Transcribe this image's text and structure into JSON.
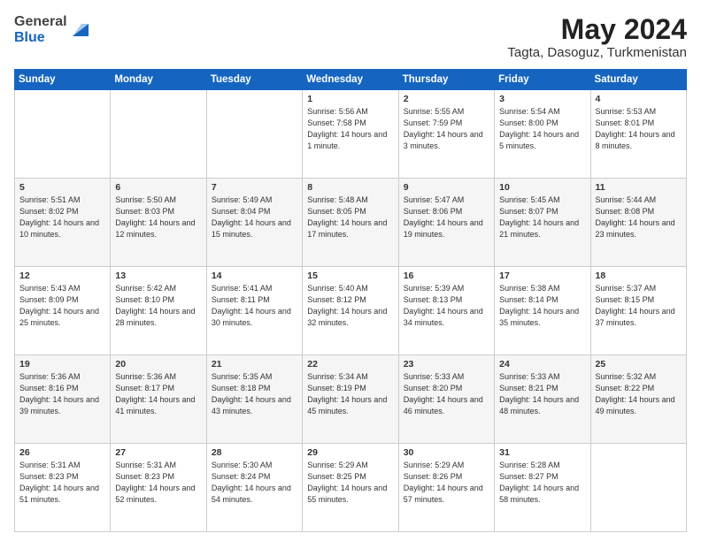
{
  "header": {
    "logo_general": "General",
    "logo_blue": "Blue",
    "month_year": "May 2024",
    "location": "Tagta, Dasoguz, Turkmenistan"
  },
  "weekdays": [
    "Sunday",
    "Monday",
    "Tuesday",
    "Wednesday",
    "Thursday",
    "Friday",
    "Saturday"
  ],
  "weeks": [
    [
      {
        "day": "",
        "sunrise": "",
        "sunset": "",
        "daylight": ""
      },
      {
        "day": "",
        "sunrise": "",
        "sunset": "",
        "daylight": ""
      },
      {
        "day": "",
        "sunrise": "",
        "sunset": "",
        "daylight": ""
      },
      {
        "day": "1",
        "sunrise": "Sunrise: 5:56 AM",
        "sunset": "Sunset: 7:58 PM",
        "daylight": "Daylight: 14 hours and 1 minute."
      },
      {
        "day": "2",
        "sunrise": "Sunrise: 5:55 AM",
        "sunset": "Sunset: 7:59 PM",
        "daylight": "Daylight: 14 hours and 3 minutes."
      },
      {
        "day": "3",
        "sunrise": "Sunrise: 5:54 AM",
        "sunset": "Sunset: 8:00 PM",
        "daylight": "Daylight: 14 hours and 5 minutes."
      },
      {
        "day": "4",
        "sunrise": "Sunrise: 5:53 AM",
        "sunset": "Sunset: 8:01 PM",
        "daylight": "Daylight: 14 hours and 8 minutes."
      }
    ],
    [
      {
        "day": "5",
        "sunrise": "Sunrise: 5:51 AM",
        "sunset": "Sunset: 8:02 PM",
        "daylight": "Daylight: 14 hours and 10 minutes."
      },
      {
        "day": "6",
        "sunrise": "Sunrise: 5:50 AM",
        "sunset": "Sunset: 8:03 PM",
        "daylight": "Daylight: 14 hours and 12 minutes."
      },
      {
        "day": "7",
        "sunrise": "Sunrise: 5:49 AM",
        "sunset": "Sunset: 8:04 PM",
        "daylight": "Daylight: 14 hours and 15 minutes."
      },
      {
        "day": "8",
        "sunrise": "Sunrise: 5:48 AM",
        "sunset": "Sunset: 8:05 PM",
        "daylight": "Daylight: 14 hours and 17 minutes."
      },
      {
        "day": "9",
        "sunrise": "Sunrise: 5:47 AM",
        "sunset": "Sunset: 8:06 PM",
        "daylight": "Daylight: 14 hours and 19 minutes."
      },
      {
        "day": "10",
        "sunrise": "Sunrise: 5:45 AM",
        "sunset": "Sunset: 8:07 PM",
        "daylight": "Daylight: 14 hours and 21 minutes."
      },
      {
        "day": "11",
        "sunrise": "Sunrise: 5:44 AM",
        "sunset": "Sunset: 8:08 PM",
        "daylight": "Daylight: 14 hours and 23 minutes."
      }
    ],
    [
      {
        "day": "12",
        "sunrise": "Sunrise: 5:43 AM",
        "sunset": "Sunset: 8:09 PM",
        "daylight": "Daylight: 14 hours and 25 minutes."
      },
      {
        "day": "13",
        "sunrise": "Sunrise: 5:42 AM",
        "sunset": "Sunset: 8:10 PM",
        "daylight": "Daylight: 14 hours and 28 minutes."
      },
      {
        "day": "14",
        "sunrise": "Sunrise: 5:41 AM",
        "sunset": "Sunset: 8:11 PM",
        "daylight": "Daylight: 14 hours and 30 minutes."
      },
      {
        "day": "15",
        "sunrise": "Sunrise: 5:40 AM",
        "sunset": "Sunset: 8:12 PM",
        "daylight": "Daylight: 14 hours and 32 minutes."
      },
      {
        "day": "16",
        "sunrise": "Sunrise: 5:39 AM",
        "sunset": "Sunset: 8:13 PM",
        "daylight": "Daylight: 14 hours and 34 minutes."
      },
      {
        "day": "17",
        "sunrise": "Sunrise: 5:38 AM",
        "sunset": "Sunset: 8:14 PM",
        "daylight": "Daylight: 14 hours and 35 minutes."
      },
      {
        "day": "18",
        "sunrise": "Sunrise: 5:37 AM",
        "sunset": "Sunset: 8:15 PM",
        "daylight": "Daylight: 14 hours and 37 minutes."
      }
    ],
    [
      {
        "day": "19",
        "sunrise": "Sunrise: 5:36 AM",
        "sunset": "Sunset: 8:16 PM",
        "daylight": "Daylight: 14 hours and 39 minutes."
      },
      {
        "day": "20",
        "sunrise": "Sunrise: 5:36 AM",
        "sunset": "Sunset: 8:17 PM",
        "daylight": "Daylight: 14 hours and 41 minutes."
      },
      {
        "day": "21",
        "sunrise": "Sunrise: 5:35 AM",
        "sunset": "Sunset: 8:18 PM",
        "daylight": "Daylight: 14 hours and 43 minutes."
      },
      {
        "day": "22",
        "sunrise": "Sunrise: 5:34 AM",
        "sunset": "Sunset: 8:19 PM",
        "daylight": "Daylight: 14 hours and 45 minutes."
      },
      {
        "day": "23",
        "sunrise": "Sunrise: 5:33 AM",
        "sunset": "Sunset: 8:20 PM",
        "daylight": "Daylight: 14 hours and 46 minutes."
      },
      {
        "day": "24",
        "sunrise": "Sunrise: 5:33 AM",
        "sunset": "Sunset: 8:21 PM",
        "daylight": "Daylight: 14 hours and 48 minutes."
      },
      {
        "day": "25",
        "sunrise": "Sunrise: 5:32 AM",
        "sunset": "Sunset: 8:22 PM",
        "daylight": "Daylight: 14 hours and 49 minutes."
      }
    ],
    [
      {
        "day": "26",
        "sunrise": "Sunrise: 5:31 AM",
        "sunset": "Sunset: 8:23 PM",
        "daylight": "Daylight: 14 hours and 51 minutes."
      },
      {
        "day": "27",
        "sunrise": "Sunrise: 5:31 AM",
        "sunset": "Sunset: 8:23 PM",
        "daylight": "Daylight: 14 hours and 52 minutes."
      },
      {
        "day": "28",
        "sunrise": "Sunrise: 5:30 AM",
        "sunset": "Sunset: 8:24 PM",
        "daylight": "Daylight: 14 hours and 54 minutes."
      },
      {
        "day": "29",
        "sunrise": "Sunrise: 5:29 AM",
        "sunset": "Sunset: 8:25 PM",
        "daylight": "Daylight: 14 hours and 55 minutes."
      },
      {
        "day": "30",
        "sunrise": "Sunrise: 5:29 AM",
        "sunset": "Sunset: 8:26 PM",
        "daylight": "Daylight: 14 hours and 57 minutes."
      },
      {
        "day": "31",
        "sunrise": "Sunrise: 5:28 AM",
        "sunset": "Sunset: 8:27 PM",
        "daylight": "Daylight: 14 hours and 58 minutes."
      },
      {
        "day": "",
        "sunrise": "",
        "sunset": "",
        "daylight": ""
      }
    ]
  ]
}
